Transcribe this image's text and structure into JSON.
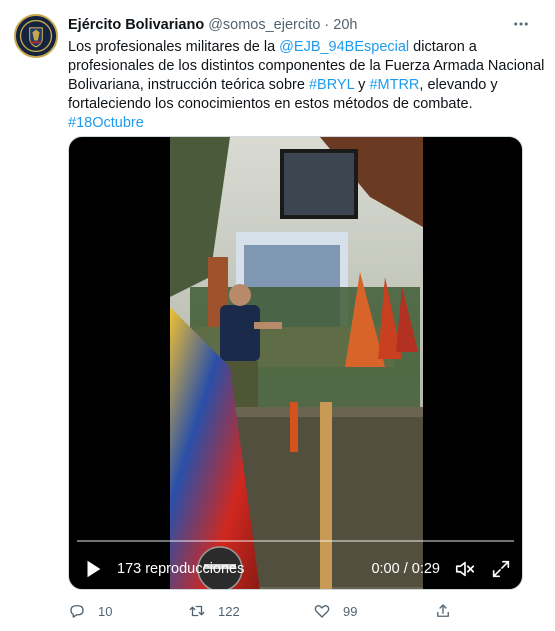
{
  "author": {
    "name": "Ejército Bolivariano",
    "handle": "@somos_ejercito",
    "separator": "·",
    "time": "20h"
  },
  "tweet": {
    "lines": [
      [
        {
          "t": "Los profesionales militares de la "
        },
        {
          "t": "@EJB_94BEspecial",
          "link": true
        },
        {
          "t": " dictaron a"
        }
      ],
      [
        {
          "t": "profesionales de los distintos componentes de la Fuerza Armada Nacional"
        }
      ],
      [
        {
          "t": "Bolivariana, instrucción teórica sobre "
        },
        {
          "t": "#BRYL",
          "link": true
        },
        {
          "t": " y "
        },
        {
          "t": "#MTRR",
          "link": true
        },
        {
          "t": ", elevando y"
        }
      ],
      [
        {
          "t": "fortaleciendo los conocimientos en estos métodos de combate."
        }
      ],
      [
        {
          "t": "#18Octubre",
          "link": true
        }
      ]
    ]
  },
  "video": {
    "views": "173 reproducciones",
    "time": "0:00 / 0:29",
    "progress": 0
  },
  "actions": {
    "replies": "10",
    "retweets": "122",
    "likes": "99"
  },
  "icons": [
    "more-icon",
    "play-icon",
    "mute-icon",
    "fullscreen-icon",
    "reply-icon",
    "retweet-icon",
    "like-icon",
    "share-icon"
  ],
  "colors": {
    "link": "#1d9bf0",
    "muted": "#536471",
    "text": "#0f1419"
  }
}
